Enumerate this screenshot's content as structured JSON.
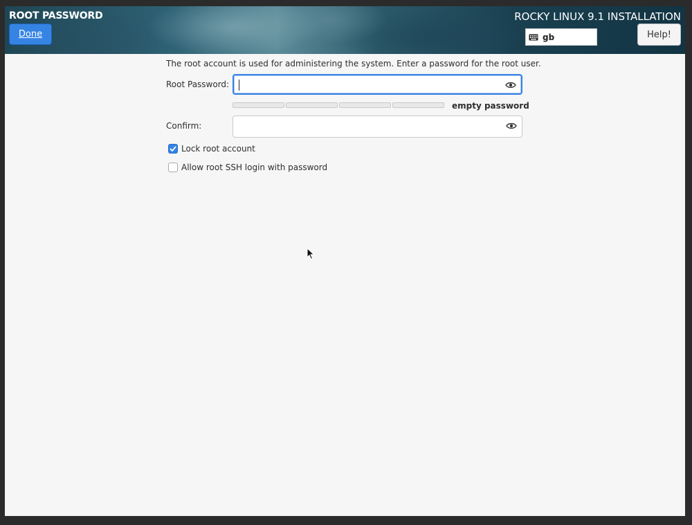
{
  "spoke": {
    "title": "ROOT PASSWORD",
    "done_label": "Done"
  },
  "product": {
    "title": "ROCKY LINUX 9.1 INSTALLATION",
    "keyboard_layout": "gb",
    "help_label": "Help!"
  },
  "form": {
    "description": "The root account is used for administering the system.  Enter a password for the root user.",
    "root_password_label": "Root Password:",
    "root_password_value": "",
    "strength_label": "empty password",
    "strength_level": 0,
    "confirm_label": "Confirm:",
    "confirm_value": "",
    "lock_root_label": "Lock root account",
    "lock_root_checked": true,
    "ssh_login_label": "Allow root SSH login with password",
    "ssh_login_checked": false
  },
  "colors": {
    "accent": "#3584e4",
    "background": "#f6f6f6"
  }
}
